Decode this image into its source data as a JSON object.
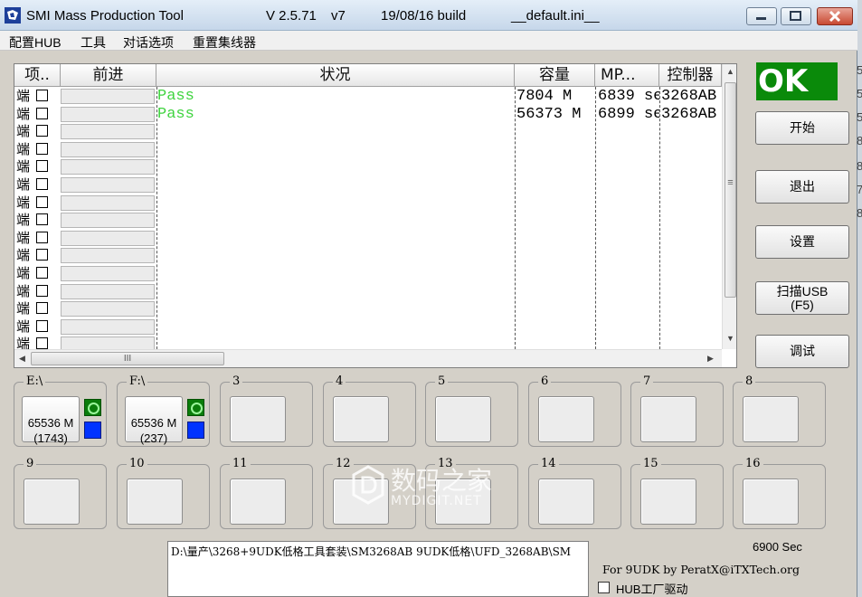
{
  "title": {
    "app_name": "SMI Mass Production Tool",
    "version": "V 2.5.71",
    "build_variant": "v7",
    "build_date": "19/08/16 build",
    "config_file": "__default.ini__"
  },
  "menu": [
    "配置HUB",
    "工具",
    "对话选项",
    "重置集线器"
  ],
  "grid": {
    "headers": [
      "项..",
      "前进",
      "状况",
      "容量",
      "MP...",
      "控制器"
    ],
    "row_label": "端",
    "row_count": 15,
    "rows": [
      {
        "status": "Pass",
        "capacity": "7804 M",
        "mp_time": "6839 se",
        "controller": "3268AB"
      },
      {
        "status": "Pass",
        "capacity": "56373 M",
        "mp_time": "6899 se",
        "controller": "3268AB"
      }
    ],
    "hscroll_glyph": "III",
    "vscroll_glyph": "≡"
  },
  "ok_badge": "OK",
  "side_buttons": [
    "开始",
    "退出",
    "设置",
    "扫描USB\n(F5)",
    "调试"
  ],
  "ports": [
    {
      "label": "E:\\",
      "capacity": "65536 M",
      "count": "(1743)",
      "status_color": "#0033ff"
    },
    {
      "label": "F:\\",
      "capacity": "65536 M",
      "count": "(237)",
      "status_color": "#0033ff"
    },
    {
      "label": "3"
    },
    {
      "label": "4"
    },
    {
      "label": "5"
    },
    {
      "label": "6"
    },
    {
      "label": "7"
    },
    {
      "label": "8"
    },
    {
      "label": "9"
    },
    {
      "label": "10"
    },
    {
      "label": "11"
    },
    {
      "label": "12"
    },
    {
      "label": "13"
    },
    {
      "label": "14"
    },
    {
      "label": "15"
    },
    {
      "label": "16"
    }
  ],
  "path_text": "D:\\量产\\3268+9UDK低格工具套装\\SM3268AB 9UDK低格\\UFD_3268AB\\SM",
  "elapsed": "6900 Sec",
  "author": "For 9UDK by PeratX@iTXTech.org",
  "hub_driver_label": "HUB工厂驱动",
  "watermark": {
    "cn": "数码之家",
    "en": "MYDIGIT.NET"
  },
  "edge_glyphs": [
    "5",
    "5",
    "5",
    "8",
    "8",
    "7",
    "8"
  ],
  "colors": {
    "ok_bg": "#0a8a0a",
    "pass_text": "#3fd33f",
    "led_blue": "#0033ff"
  }
}
